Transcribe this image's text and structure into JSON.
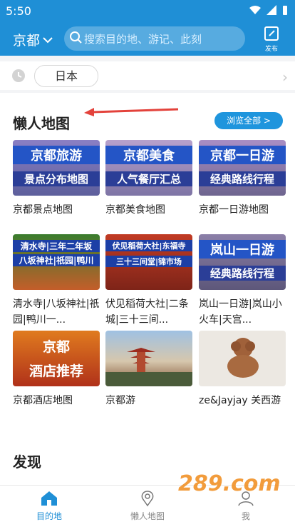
{
  "status": {
    "time": "5:50"
  },
  "header": {
    "city": "京都",
    "search_placeholder": "搜索目的地、游记、此刻",
    "publish_label": "发布"
  },
  "filter": {
    "chip": "日本"
  },
  "maps_section": {
    "title": "懒人地图",
    "browse_all": "浏览全部 >",
    "cards": [
      {
        "label_1": "京都旅游",
        "label_2": "景点分布地图",
        "caption": "京都景点地图"
      },
      {
        "label_1": "京都美食",
        "label_2": "人气餐厅汇总",
        "caption": "京都美食地图"
      },
      {
        "label_1": "京都一日游",
        "label_2": "经典路线行程",
        "caption": "京都一日游地图"
      },
      {
        "label_1": "清水寺|三年二年坂",
        "label_2": "八坂神社|祇园|鸭川",
        "caption": "清水寺|八坂神社|祇园|鸭川一..."
      },
      {
        "label_1": "伏见稻荷大社|东福寺",
        "label_2": "三十三间堂|锦市场",
        "caption": "伏见稻荷大社|二条城|三十三间..."
      },
      {
        "label_1": "岚山一日游",
        "label_2": "经典路线行程",
        "caption": "岚山一日游|岚山小火车|天宫..."
      },
      {
        "label_1": "京都",
        "label_2": "酒店推荐",
        "caption": "京都酒店地图"
      },
      {
        "label_1": "",
        "label_2": "",
        "caption": "京都游"
      },
      {
        "label_1": "",
        "label_2": "",
        "caption": "ze&Jayjay 关西游"
      }
    ]
  },
  "discover": {
    "title": "发现"
  },
  "nav": {
    "home": "目的地",
    "maps": "懒人地图",
    "me": "我"
  },
  "watermark": "289.com"
}
